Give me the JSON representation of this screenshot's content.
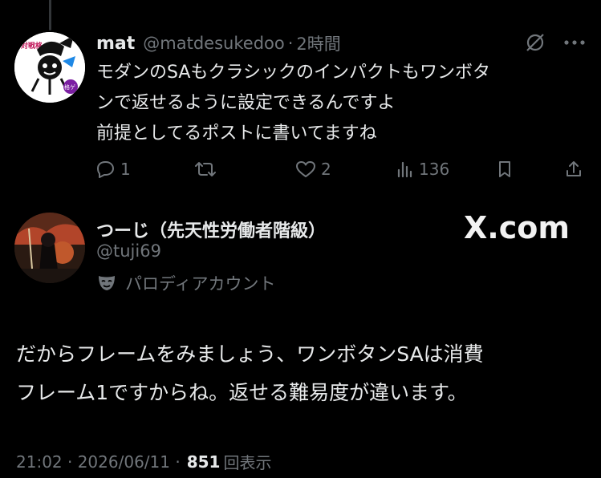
{
  "reply_post": {
    "display_name": "mat",
    "handle": "@matdesukedoo",
    "time": "2時間",
    "lines": [
      "モダンのSAもクラシックのインパクトもワンボタ",
      "ンで返せるように設定できるんですよ",
      "前提としてるポストに書いてますね"
    ],
    "actions": {
      "replies": "1",
      "reposts": "",
      "likes": "2",
      "views": "136"
    },
    "header_icons": [
      "grok-icon",
      "more-icon"
    ]
  },
  "main_post": {
    "display_name": "つーじ（先天性労働者階級）",
    "handle": "@tuji69",
    "label": "パロディアカウント",
    "watermark": "X.com",
    "lines": [
      "だからフレームをみましょう、ワンボタンSAは消費",
      "フレーム1ですからね。返せる難易度が違います。"
    ],
    "timestamp": "21:02 · 2026/06/11 ·",
    "views_count": "851",
    "views_label": "回表示"
  },
  "colors": {
    "background": "#000000",
    "text_primary": "#e7e9ea",
    "text_secondary": "#71767b",
    "thread_line": "#333639"
  }
}
